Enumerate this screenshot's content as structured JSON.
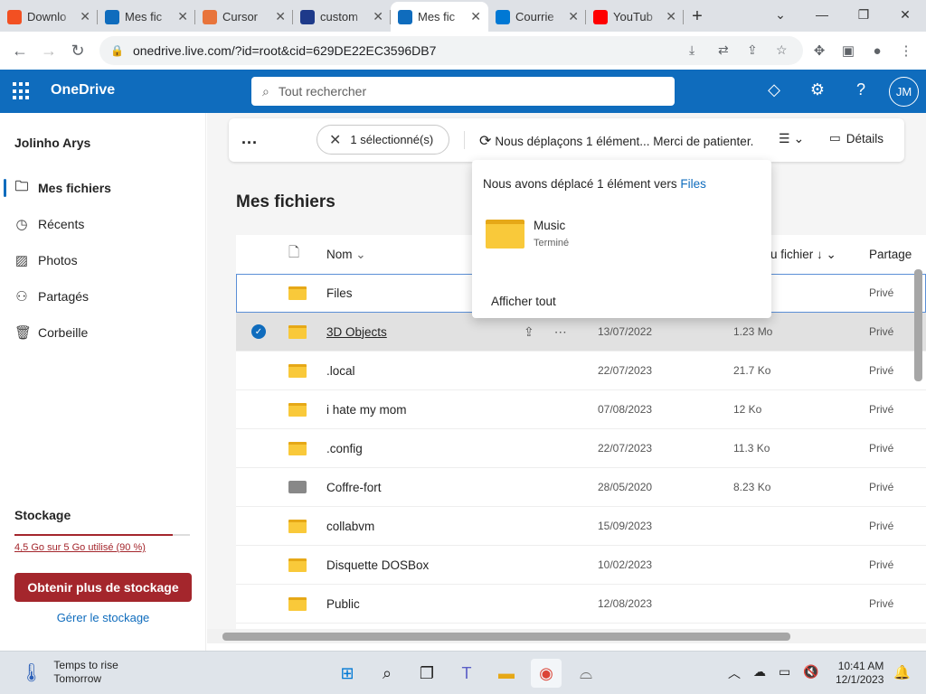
{
  "browser": {
    "tabs": [
      {
        "title": "Downlo",
        "icon": "microsoft-icon",
        "active": false
      },
      {
        "title": "Mes fic",
        "icon": "onedrive-icon",
        "active": false
      },
      {
        "title": "Cursor",
        "icon": "rainbow-icon",
        "active": false
      },
      {
        "title": "custom",
        "icon": "cursor-arrow-icon",
        "active": false
      },
      {
        "title": "Mes fic",
        "icon": "onedrive-icon",
        "active": true
      },
      {
        "title": "Courrie",
        "icon": "outlook-icon",
        "active": false
      },
      {
        "title": "YouTub",
        "icon": "youtube-icon",
        "active": false
      }
    ],
    "url": "onedrive.live.com/?id=root&cid=629DE22EC3596DB7"
  },
  "app": {
    "title": "OneDrive",
    "search_placeholder": "Tout rechercher",
    "avatar_initials": "JM"
  },
  "sidebar": {
    "user_name": "Jolinho Arys",
    "items": [
      {
        "label": "Mes fichiers",
        "selected": true
      },
      {
        "label": "Récents",
        "selected": false
      },
      {
        "label": "Photos",
        "selected": false
      },
      {
        "label": "Partagés",
        "selected": false
      },
      {
        "label": "Corbeille",
        "selected": false
      }
    ],
    "storage_title": "Stockage",
    "storage_used": "4,5 Go sur 5 Go utilisé (90 %)",
    "storage_fraction": 0.9,
    "get_storage": "Obtenir plus de stockage",
    "manage_storage": "Gérer le stockage"
  },
  "commandbar": {
    "more": "...",
    "selected": "1 sélectionné(s)",
    "moving": "Nous déplaçons 1 élément... Merci de patienter.",
    "details": "Détails"
  },
  "main": {
    "title": "Mes fichiers",
    "columns": {
      "name": "Nom",
      "modified": "lu fichier",
      "sharing": "Partage"
    },
    "rows": [
      {
        "name": "Files",
        "date": "",
        "size": "",
        "sharing": "Privé",
        "type": "folder",
        "state": "focus"
      },
      {
        "name": "3D Objects",
        "date": "13/07/2022",
        "size": "1.23 Mo",
        "sharing": "Privé",
        "type": "folder",
        "state": "selected"
      },
      {
        "name": ".local",
        "date": "22/07/2023",
        "size": "21.7 Ko",
        "sharing": "Privé",
        "type": "folder",
        "state": ""
      },
      {
        "name": "i hate my mom",
        "date": "07/08/2023",
        "size": "12 Ko",
        "sharing": "Privé",
        "type": "folder",
        "state": ""
      },
      {
        "name": ".config",
        "date": "22/07/2023",
        "size": "11.3 Ko",
        "sharing": "Privé",
        "type": "folder",
        "state": ""
      },
      {
        "name": "Coffre-fort",
        "date": "28/05/2020",
        "size": "8.23 Ko",
        "sharing": "Privé",
        "type": "vault",
        "state": ""
      },
      {
        "name": "collabvm",
        "date": "15/09/2023",
        "size": "",
        "sharing": "Privé",
        "type": "folder",
        "state": ""
      },
      {
        "name": "Disquette DOSBox",
        "date": "10/02/2023",
        "size": "",
        "sharing": "Privé",
        "type": "folder",
        "state": ""
      },
      {
        "name": "Public",
        "date": "12/08/2023",
        "size": "",
        "sharing": "Privé",
        "type": "folder",
        "state": ""
      }
    ]
  },
  "popup": {
    "message": "Nous avons déplacé 1 élément vers",
    "link": "Files",
    "item_name": "Music",
    "item_status": "Terminé",
    "show_all": "Afficher tout"
  },
  "taskbar": {
    "weather_line1": "Temps to rise",
    "weather_line2": "Tomorrow",
    "time": "10:41 AM",
    "date": "12/1/2023"
  }
}
